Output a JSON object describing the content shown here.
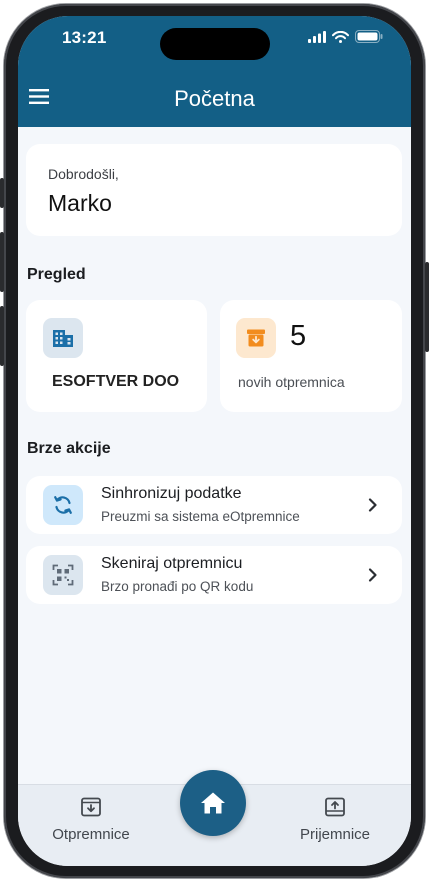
{
  "status_bar": {
    "time": "13:21"
  },
  "header": {
    "title": "Početna"
  },
  "welcome": {
    "greeting": "Dobrodošli,",
    "name": "Marko"
  },
  "overview": {
    "title": "Pregled",
    "company_name": "ESOFTVER DOO",
    "new_shipments_count": "5",
    "new_shipments_label": "novih otpremnica"
  },
  "quick_actions": {
    "title": "Brze akcije",
    "items": [
      {
        "title": "Sinhronizuj podatke",
        "subtitle": "Preuzmi sa sistema eOtpremnice",
        "icon": "sync-icon"
      },
      {
        "title": "Skeniraj otpremnicu",
        "subtitle": "Brzo pronađi po QR kodu",
        "icon": "qr-scan-icon"
      }
    ]
  },
  "bottom_nav": {
    "items": [
      {
        "label": "Otpremnice",
        "icon": "inbox-download-icon"
      },
      {
        "label": "Prijemnice",
        "icon": "inbox-upload-icon"
      }
    ],
    "center": {
      "icon": "home-icon"
    }
  },
  "colors": {
    "header": "#135f86",
    "background": "#f4f7fb",
    "accent_blue_tile": "#cfe8fb",
    "accent_orange_tile": "#fde8cf",
    "orange_icon": "#f28c1e",
    "blue_icon": "#1b6fa8"
  }
}
